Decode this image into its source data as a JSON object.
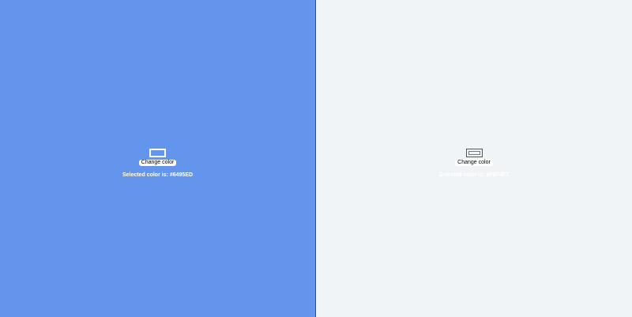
{
  "panes": [
    {
      "background": "#6495ED",
      "swatch_border": "#ffffff",
      "button_label": "Change color",
      "status_text": "Selected color is: #6495ED",
      "status_color": "#ffffff"
    },
    {
      "background": "#F0F4F7",
      "swatch_border": "#555555",
      "button_label": "Change color",
      "status_text": "Selected color is: #F0F4F7",
      "status_color": "#ffffff"
    }
  ]
}
